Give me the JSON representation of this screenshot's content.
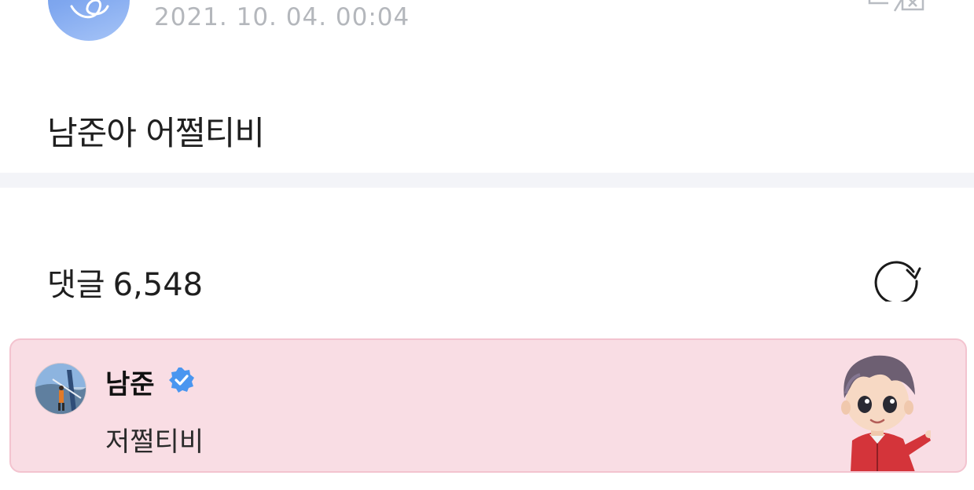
{
  "post": {
    "date": "2021. 10. 04. 00:04",
    "body": "남준아 어쩔티비"
  },
  "comments": {
    "label": "댓글",
    "count": "6,548"
  },
  "highlighted_comment": {
    "author": "남준",
    "text": "저쩔티비",
    "background_color": "#f9dde4",
    "verified_color": "#4a96f0"
  },
  "icons": {
    "translate": "translate-icon",
    "refresh": "refresh-icon",
    "verified": "verified-badge-icon"
  }
}
